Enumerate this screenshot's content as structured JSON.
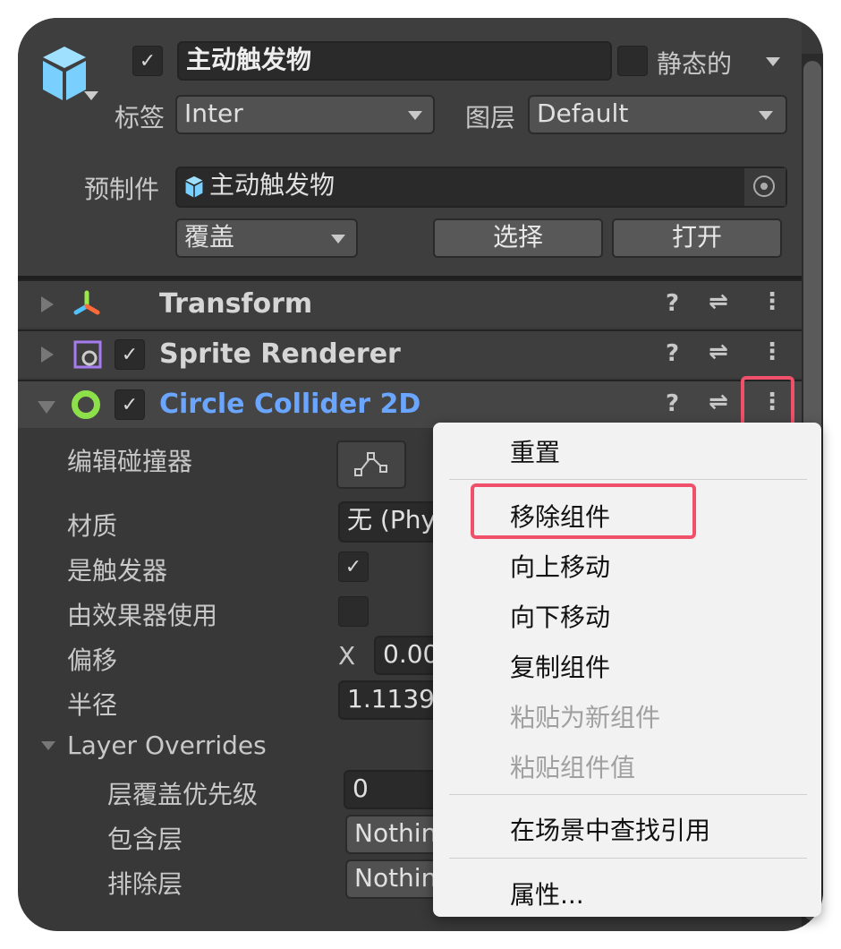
{
  "header": {
    "name": "主动触发物",
    "active": true,
    "static_label": "静态的",
    "static": false,
    "tag_label": "标签",
    "tag_value": "Inter",
    "layer_label": "图层",
    "layer_value": "Default",
    "prefab_label": "预制件",
    "prefab_value": "主动触发物",
    "overrides_label": "覆盖",
    "select_label": "选择",
    "open_label": "打开"
  },
  "components": [
    {
      "name": "Transform",
      "expanded": false
    },
    {
      "name": "Sprite Renderer",
      "enabled": true,
      "expanded": false
    },
    {
      "name": "Circle Collider 2D",
      "enabled": true,
      "expanded": true,
      "color": "#6aa6ff"
    }
  ],
  "collider": {
    "edit_label": "编辑碰撞器",
    "material_label": "材质",
    "material_value": "无 (Phy",
    "trigger_label": "是触发器",
    "is_trigger": true,
    "effector_label": "由效果器使用",
    "used_by_effector": false,
    "offset_label": "偏移",
    "offset_axis": "X",
    "offset_x": "0.00",
    "radius_label": "半径",
    "radius_value": "1.1139",
    "layer_overrides_label": "Layer Overrides",
    "priority_label": "层覆盖优先级",
    "priority_value": "0",
    "include_label": "包含层",
    "include_value": "Nothin",
    "exclude_label": "排除层",
    "exclude_value": "Nothin"
  },
  "context_menu": {
    "items": [
      {
        "label": "重置",
        "enabled": true
      },
      {
        "label": "移除组件",
        "enabled": true,
        "highlighted": true
      },
      {
        "label": "向上移动",
        "enabled": true
      },
      {
        "label": "向下移动",
        "enabled": true
      },
      {
        "label": "复制组件",
        "enabled": true
      },
      {
        "label": "粘贴为新组件",
        "enabled": false
      },
      {
        "label": "粘贴组件值",
        "enabled": false
      },
      {
        "label": "在场景中查找引用",
        "enabled": true
      },
      {
        "label": "属性...",
        "enabled": true
      }
    ]
  },
  "colors": {
    "highlight": "#f0506a",
    "cube": "#79d0ff",
    "collider_icon": "#8ee04a",
    "sprite_icon": "#a57cf0"
  }
}
